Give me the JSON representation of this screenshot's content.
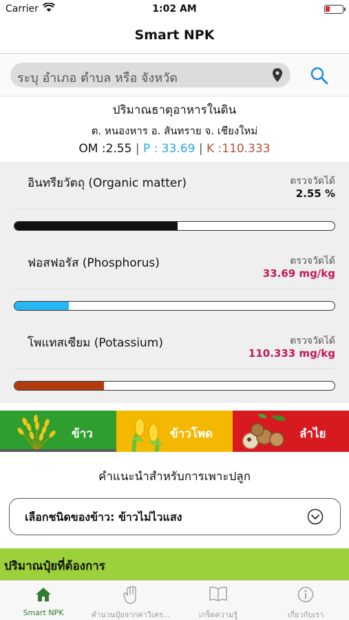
{
  "status_bar": {
    "carrier": "Carrier",
    "time": "1:02 AM"
  },
  "nav": {
    "title": "Smart NPK"
  },
  "search": {
    "placeholder": "ระบุ อำเภอ ตำบล หรือ จังหวัด",
    "pin_icon": "location-pin-icon",
    "search_icon": "search-icon"
  },
  "summary": {
    "title": "ปริมาณธาตุอาหารในดิน",
    "location": "ต. หนองหาร อ. สันทราย จ. เชียงใหม่",
    "om": "OM :2.55",
    "p": "P : 33.69",
    "k": "K :110.333",
    "separator": "|"
  },
  "nutrients": [
    {
      "name": "อินทรียวัตถุ  (Organic matter)",
      "measured_label": "ตรวจวัดได้",
      "value": "2.55 %",
      "value_color": "#111111",
      "bar_color": "#111111",
      "level": 0.51
    },
    {
      "name": "ฟอสฟอรัส  (Phosphorus)",
      "measured_label": "ตรวจวัดได้",
      "value": "33.69 mg/kg",
      "value_color": "#c2185b",
      "bar_color": "#29b6f6",
      "level": 0.17
    },
    {
      "name": "โพแทสเซียม  (Potassium)",
      "measured_label": "ตรวจวัดได้",
      "value": "110.333 mg/kg",
      "value_color": "#c2185b",
      "bar_color": "#b23c10",
      "level": 0.28
    }
  ],
  "crops": [
    {
      "label": "ข้าว",
      "bg": "#2e9f2e",
      "icon": "rice-plant-icon"
    },
    {
      "label": "ข้าวโพด",
      "bg": "#f5b800",
      "icon": "corn-icon"
    },
    {
      "label": "ลำไย",
      "bg": "#d71920",
      "icon": "longan-icon"
    }
  ],
  "recommendation": {
    "title": "คำแนะนำสำหรับการเพาะปลูก",
    "select_label": "เลือกชนิดของข้าว: ข้าวไม่ไวแสง",
    "chevron_icon": "chevron-down-icon"
  },
  "fertilizer": {
    "title": "ปริมาณปุ๋ยที่ต้องการ"
  },
  "tabs": [
    {
      "label": "Smart NPK",
      "icon": "home-icon"
    },
    {
      "label": "คำนวนปุ๋ยจากค่าวิเคร...",
      "icon": "hand-icon"
    },
    {
      "label": "เกร็ดความรู้",
      "icon": "book-icon"
    },
    {
      "label": "เกี่ยวกับเรา",
      "icon": "info-icon"
    }
  ],
  "colors": {
    "accent": "#1e88e5",
    "active_tab": "#2e7d32",
    "fert_header": "#9cd13b"
  }
}
